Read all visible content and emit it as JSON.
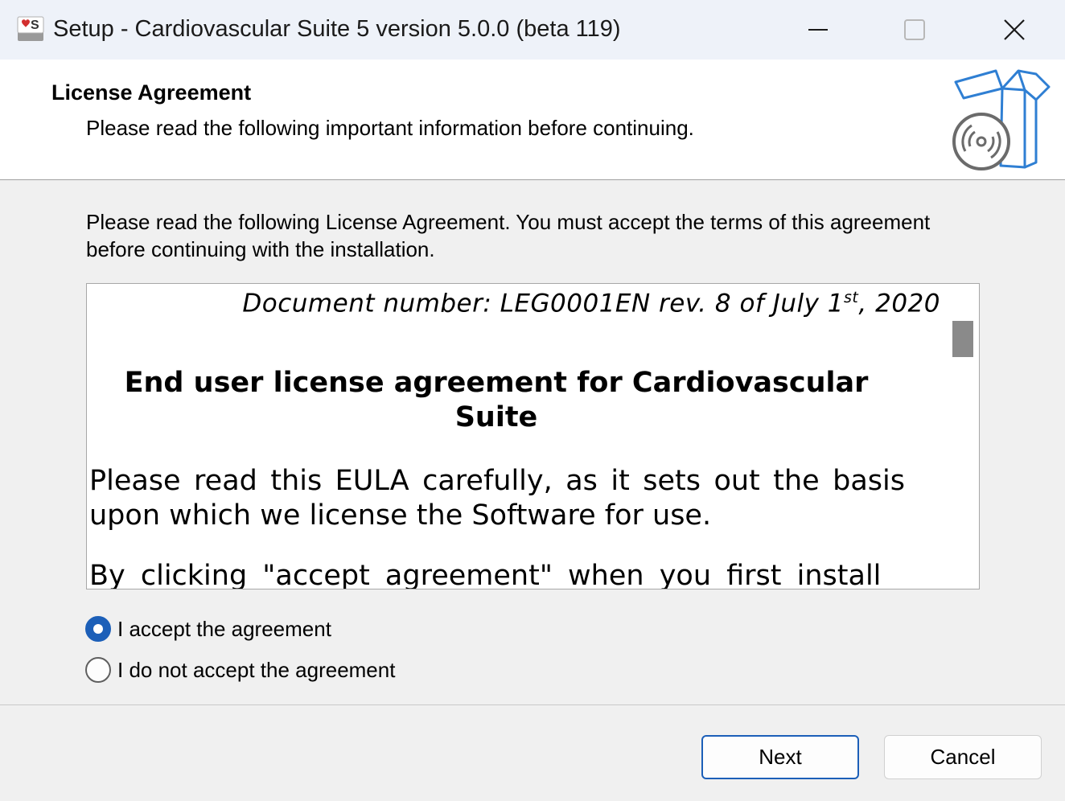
{
  "window": {
    "title": "Setup - Cardiovascular Suite 5 version 5.0.0 (beta 119)",
    "app_icon": "cardiovascular-suite-icon",
    "controls": [
      "minimize-icon",
      "maximize-icon",
      "close-icon"
    ]
  },
  "header": {
    "title": "License Agreement",
    "subtitle": "Please read the following important information before continuing.",
    "icon": "software-box-disc-icon"
  },
  "body": {
    "intro": "Please read the following License Agreement. You must accept the terms of this agreement before continuing with the installation."
  },
  "license": {
    "doc_number_prefix": "Document number: LEG0001EN rev. 8 of July 1",
    "doc_number_sup": "st",
    "doc_number_suffix": ", 2020",
    "heading": "End user license agreement for Cardiovascular Suite",
    "para1": "Please read this EULA carefully, as it sets out the basis upon which we license the Software for use.",
    "para2": "By clicking \"accept agreement\" when you first install"
  },
  "options": {
    "accept_label": "I accept the agreement",
    "decline_label": "I do not accept the agreement",
    "selected": "accept"
  },
  "buttons": {
    "next_label": "Next",
    "cancel_label": "Cancel"
  },
  "colors": {
    "accent": "#1c5fb8",
    "titlebar": "#eef2f9",
    "dialog_bg": "#f0f0f0",
    "icon_blue": "#2f7fd3",
    "brand_red": "#d32f2f"
  }
}
